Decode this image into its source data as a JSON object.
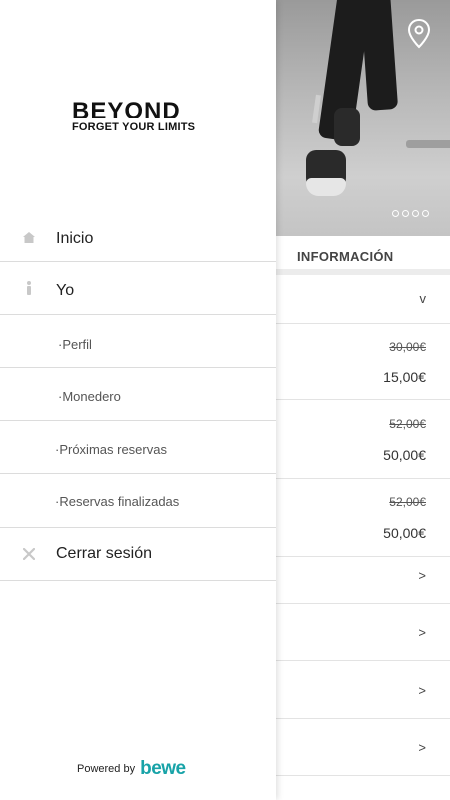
{
  "background": {
    "section_title": "INFORMACIÓN",
    "rows": [
      {
        "type": "dropdown",
        "chevron": "v"
      },
      {
        "type": "price",
        "old": "30,00€",
        "new": "15,00€"
      },
      {
        "type": "price",
        "old": "52,00€",
        "new": "50,00€"
      },
      {
        "type": "price",
        "old": "52,00€",
        "new": "50,00€"
      },
      {
        "type": "link",
        "chevron": ">"
      },
      {
        "type": "link",
        "chevron": ">"
      },
      {
        "type": "link",
        "chevron": ">"
      },
      {
        "type": "link",
        "chevron": ">"
      }
    ],
    "carousel_dots": 4,
    "icons": {
      "pin": "location-pin-icon"
    }
  },
  "drawer": {
    "logo": {
      "word": "BEYOND",
      "tagline": "FORGET YOUR LIMITS"
    },
    "menu": {
      "inicio": "Inicio",
      "yo": "Yo",
      "perfil": "·Perfil",
      "monedero": "·Monedero",
      "proximas": "·Próximas reservas",
      "finalizadas": "·Reservas finalizadas",
      "cerrar": "Cerrar sesión"
    },
    "icons": {
      "inicio": "home-icon",
      "yo": "person-icon",
      "cerrar": "close-icon"
    },
    "footer": {
      "powered_by": "Powered by",
      "brand": "bewe"
    }
  },
  "colors": {
    "brand": "#18a3a8",
    "icon_gray": "#c8c8c8",
    "divider": "#dcdcdc"
  }
}
